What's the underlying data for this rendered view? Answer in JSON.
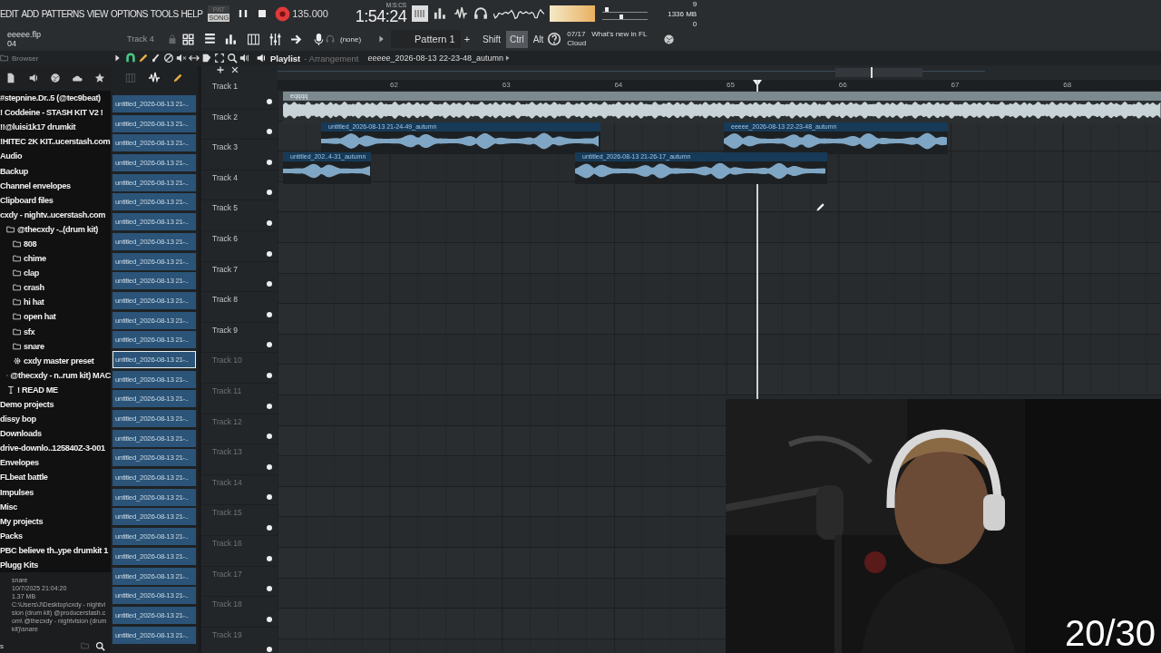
{
  "menu": [
    "EDIT",
    "ADD",
    "PATTERNS",
    "VIEW",
    "OPTIONS",
    "TOOLS",
    "HELP"
  ],
  "transport": {
    "modes": [
      {
        "label": "PAT",
        "selected": false
      },
      {
        "label": "SONG",
        "selected": true
      }
    ],
    "tempo": "135.000",
    "time": "1:54:24",
    "time_unit": "M:S:CS"
  },
  "monitor": {
    "voices": "9",
    "memory": "1336 MB",
    "column_3": "0",
    "sliders": [
      {
        "level": 0.05
      },
      {
        "level": 0.4
      }
    ]
  },
  "project": {
    "file": "eeeee.flp",
    "line_2": "04"
  },
  "toolbar": {
    "hint": "Track 4",
    "channel": "(none)",
    "pattern": "Pattern 1",
    "add": "+",
    "modifiers": [
      {
        "label": "Shift",
        "selected": false
      },
      {
        "label": "Ctrl",
        "selected": true
      },
      {
        "label": "Alt",
        "selected": false
      }
    ],
    "news": {
      "date": "07/17",
      "title": "What's new in FL",
      "subtitle": "Cloud"
    }
  },
  "browser": {
    "title": "Browser",
    "items": [
      {
        "label": "#stepnine.Dr..5 (@tec9beat)"
      },
      {
        "label": "! Coddeine - STASH KIT V2 !"
      },
      {
        "label": "!!@luisi1k17 drumkit"
      },
      {
        "label": "!HITEC 2K KIT..ucerstash.com"
      },
      {
        "label": "Audio"
      },
      {
        "label": "Backup"
      },
      {
        "label": "Channel envelopes"
      },
      {
        "label": "Clipboard files"
      },
      {
        "label": "cxdy - nightv..ucerstash.com",
        "children": [
          {
            "label": "@thecxdy -..(drum kit)",
            "kind": "folder",
            "children": [
              {
                "label": "808",
                "kind": "folder"
              },
              {
                "label": "chime",
                "kind": "folder"
              },
              {
                "label": "clap",
                "kind": "folder"
              },
              {
                "label": "crash",
                "kind": "folder"
              },
              {
                "label": "hi hat",
                "kind": "folder"
              },
              {
                "label": "open hat",
                "kind": "folder"
              },
              {
                "label": "sfx",
                "kind": "folder"
              },
              {
                "label": "snare",
                "kind": "folder"
              },
              {
                "label": "cxdy master preset",
                "kind": "preset"
              }
            ]
          },
          {
            "label": "@thecxdy - n..rum kit) MAC",
            "kind": "folder"
          },
          {
            "label": "! READ ME",
            "kind": "text"
          }
        ]
      },
      {
        "label": "Demo projects"
      },
      {
        "label": "dissy bop"
      },
      {
        "label": "Downloads"
      },
      {
        "label": "drive-downlo..125840Z-3-001"
      },
      {
        "label": "Envelopes"
      },
      {
        "label": "FLbeat battle"
      },
      {
        "label": "Impulses"
      },
      {
        "label": "Misc"
      },
      {
        "label": "My projects"
      },
      {
        "label": "Packs"
      },
      {
        "label": "PBC believe th..ype drumkit 1"
      },
      {
        "label": "Plugg Kits"
      }
    ],
    "info": {
      "name": "snare",
      "date": "10/7/2025 21:04:20",
      "size": "1.37 MB",
      "path": "C:\\Users\\J\\Desktop\\cxdy - nightvision (drum kit) @producerstash.com\\ @thecxdy - nightvision (drum kit)\\snare"
    },
    "footer": "s"
  },
  "channels": [
    {
      "label": "untitled_2026-08-13 21-..",
      "selected": false
    },
    {
      "label": "untitled_2026-08-13 21-..",
      "selected": false
    },
    {
      "label": "untitled_2026-08-13 21-..",
      "selected": false
    },
    {
      "label": "untitled_2026-08-13 21-..",
      "selected": false
    },
    {
      "label": "untitled_2026-08-13 21-..",
      "selected": false
    },
    {
      "label": "untitled_2026-08-13 21-..",
      "selected": false
    },
    {
      "label": "untitled_2026-08-13 21-..",
      "selected": false
    },
    {
      "label": "untitled_2026-08-13 21-..",
      "selected": false
    },
    {
      "label": "untitled_2026-08-13 21-..",
      "selected": false
    },
    {
      "label": "untitled_2026-08-13 21-..",
      "selected": false
    },
    {
      "label": "untitled_2026-08-13 21-..",
      "selected": false
    },
    {
      "label": "untitled_2026-08-13 21-..",
      "selected": false
    },
    {
      "label": "untitled_2026-08-13 21-..",
      "selected": false
    },
    {
      "label": "untitled_2026-08-13 21-..",
      "selected": true
    },
    {
      "label": "untitled_2026-08-13 21-..",
      "selected": false
    },
    {
      "label": "untitled_2026-08-13 21-..",
      "selected": false
    },
    {
      "label": "untitled_2026-08-13 21-..",
      "selected": false
    },
    {
      "label": "untitled_2026-08-13 21-..",
      "selected": false
    },
    {
      "label": "untitled_2026-08-13 21-..",
      "selected": false
    },
    {
      "label": "untitled_2026-08-13 21-..",
      "selected": false
    },
    {
      "label": "untitled_2026-08-13 21-..",
      "selected": false
    },
    {
      "label": "untitled_2026-08-13 21-..",
      "selected": false
    },
    {
      "label": "untitled_2026-08-13 21-..",
      "selected": false
    },
    {
      "label": "untitled_2026-08-13 21-..",
      "selected": false
    },
    {
      "label": "untitled_2026-08-13 21-..",
      "selected": false
    },
    {
      "label": "untitled_2026-08-13 21-..",
      "selected": false
    },
    {
      "label": "untitled_2026-08-13 21-..",
      "selected": false
    },
    {
      "label": "untitled_2026-08-13 21-..",
      "selected": false
    }
  ],
  "playlist": {
    "title": "Playlist",
    "subtitle": "- Arrangement",
    "current": "eeeee_2026-08-13 22-23-48_autumn",
    "ruler": [
      "62",
      "63",
      "64",
      "65",
      "66",
      "67",
      "68"
    ],
    "tracks": [
      {
        "name": "Track 1",
        "dimmed": false,
        "clips": [
          {
            "label": "eqqqq",
            "kind": "master"
          }
        ]
      },
      {
        "name": "Track 2",
        "dimmed": false,
        "clips": [
          {
            "label": "untitled_2026-08-13 21-24-49_autumn",
            "kind": "audio"
          },
          {
            "label": "eeeee_2026-08-13 22-23-48_autumn",
            "kind": "audio"
          }
        ]
      },
      {
        "name": "Track 3",
        "dimmed": false,
        "clips": [
          {
            "label": "untitled_202..4-31_autumn",
            "kind": "audio"
          },
          {
            "label": "untitled_2026-08-13 21-26-17_autumn",
            "kind": "audio"
          }
        ]
      },
      {
        "name": "Track 4",
        "dimmed": false
      },
      {
        "name": "Track 5",
        "dimmed": false
      },
      {
        "name": "Track 6",
        "dimmed": false
      },
      {
        "name": "Track 7",
        "dimmed": false
      },
      {
        "name": "Track 8",
        "dimmed": false
      },
      {
        "name": "Track 9",
        "dimmed": false
      },
      {
        "name": "Track 10",
        "dimmed": true
      },
      {
        "name": "Track 11",
        "dimmed": true
      },
      {
        "name": "Track 12",
        "dimmed": true
      },
      {
        "name": "Track 13",
        "dimmed": true
      },
      {
        "name": "Track 14",
        "dimmed": true
      },
      {
        "name": "Track 15",
        "dimmed": true
      },
      {
        "name": "Track 16",
        "dimmed": true
      },
      {
        "name": "Track 17",
        "dimmed": true
      },
      {
        "name": "Track 18",
        "dimmed": true
      },
      {
        "name": "Track 19",
        "dimmed": true
      }
    ]
  },
  "webcam": {
    "counter": "20/30"
  }
}
